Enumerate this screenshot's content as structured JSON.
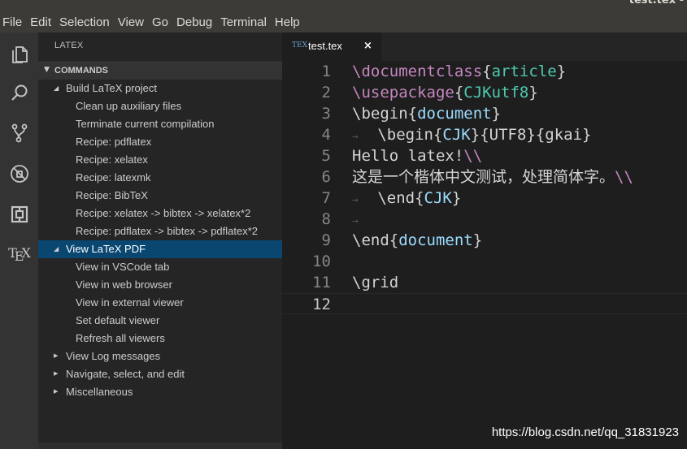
{
  "window": {
    "title": "test.tex -"
  },
  "menubar": [
    "File",
    "Edit",
    "Selection",
    "View",
    "Go",
    "Debug",
    "Terminal",
    "Help"
  ],
  "activity_bar": {
    "icons": [
      "files-icon",
      "search-icon",
      "source-control-icon",
      "debug-icon",
      "extensions-icon",
      "tex-icon"
    ],
    "tex_label": "TEX"
  },
  "sidebar": {
    "panel_title": "LATEX",
    "section": "COMMANDS",
    "tree": [
      {
        "label": "Build LaTeX project",
        "level": 1,
        "expanded": true
      },
      {
        "label": "Clean up auxiliary files",
        "level": 2
      },
      {
        "label": "Terminate current compilation",
        "level": 2
      },
      {
        "label": "Recipe: pdflatex",
        "level": 2
      },
      {
        "label": "Recipe: xelatex",
        "level": 2
      },
      {
        "label": "Recipe: latexmk",
        "level": 2
      },
      {
        "label": "Recipe: BibTeX",
        "level": 2
      },
      {
        "label": "Recipe: xelatex -> bibtex -> xelatex*2",
        "level": 2
      },
      {
        "label": "Recipe: pdflatex -> bibtex -> pdflatex*2",
        "level": 2
      },
      {
        "label": "View LaTeX PDF",
        "level": 1,
        "expanded": true,
        "selected": true
      },
      {
        "label": "View in VSCode tab",
        "level": 2
      },
      {
        "label": "View in web browser",
        "level": 2
      },
      {
        "label": "View in external viewer",
        "level": 2
      },
      {
        "label": "Set default viewer",
        "level": 2
      },
      {
        "label": "Refresh all viewers",
        "level": 2
      },
      {
        "label": "View Log messages",
        "level": 1,
        "expanded": false
      },
      {
        "label": "Navigate, select, and edit",
        "level": 1,
        "expanded": false
      },
      {
        "label": "Miscellaneous",
        "level": 1,
        "expanded": false
      }
    ]
  },
  "editor": {
    "tab": {
      "icon": "TEX",
      "label": "test.tex",
      "close": "×"
    },
    "current_line": 12,
    "lines": [
      {
        "n": "1",
        "tokens": [
          [
            "cmd",
            "\\documentclass"
          ],
          [
            "brace",
            "{"
          ],
          [
            "arg",
            "article"
          ],
          [
            "brace",
            "}"
          ]
        ]
      },
      {
        "n": "2",
        "tokens": [
          [
            "cmd",
            "\\usepackage"
          ],
          [
            "brace",
            "{"
          ],
          [
            "arg",
            "CJKutf8"
          ],
          [
            "brace",
            "}"
          ]
        ]
      },
      {
        "n": "3",
        "tokens": [
          [
            "plain",
            "\\begin"
          ],
          [
            "brace",
            "{"
          ],
          [
            "argb",
            "document"
          ],
          [
            "brace",
            "}"
          ]
        ]
      },
      {
        "n": "4",
        "tokens": [
          [
            "ws",
            "→   "
          ],
          [
            "plain",
            "\\begin"
          ],
          [
            "brace",
            "{"
          ],
          [
            "argb",
            "CJK"
          ],
          [
            "brace",
            "}"
          ],
          [
            "plain",
            "{UTF8}{gkai}"
          ]
        ]
      },
      {
        "n": "5",
        "tokens": [
          [
            "plain",
            "Hello latex!"
          ],
          [
            "bsl",
            "\\\\"
          ]
        ]
      },
      {
        "n": "6",
        "tokens": [
          [
            "plain",
            "这是一个楷体中文测试，处理简体字。"
          ],
          [
            "bsl",
            "\\\\"
          ]
        ]
      },
      {
        "n": "7",
        "tokens": [
          [
            "ws",
            "→   "
          ],
          [
            "plain",
            "\\end"
          ],
          [
            "brace",
            "{"
          ],
          [
            "argb",
            "CJK"
          ],
          [
            "brace",
            "}"
          ]
        ]
      },
      {
        "n": "8",
        "tokens": [
          [
            "ws",
            "→"
          ]
        ]
      },
      {
        "n": "9",
        "tokens": [
          [
            "plain",
            "\\end"
          ],
          [
            "brace",
            "{"
          ],
          [
            "argb",
            "document"
          ],
          [
            "brace",
            "}"
          ]
        ]
      },
      {
        "n": "10",
        "tokens": []
      },
      {
        "n": "11",
        "tokens": [
          [
            "plain",
            "\\grid"
          ]
        ]
      },
      {
        "n": "12",
        "tokens": []
      }
    ]
  },
  "watermark": "https://blog.csdn.net/qq_31831923",
  "colors": {
    "selection": "#094771",
    "keyword": "#c586c0",
    "argument": "#4ec9b0",
    "argument_blue": "#9cdcfe"
  }
}
